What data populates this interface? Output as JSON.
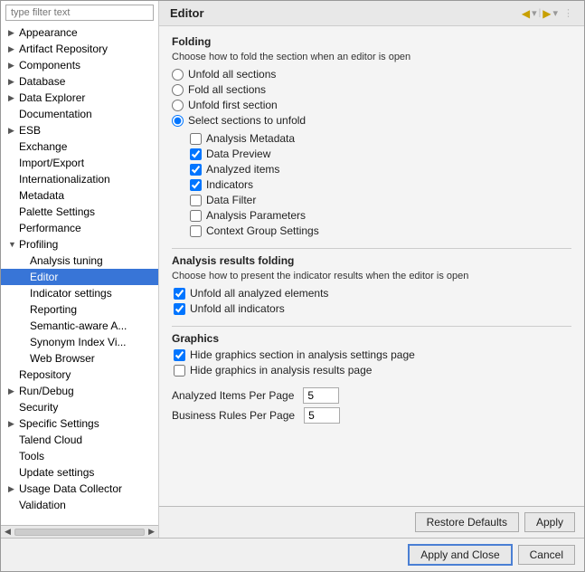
{
  "dialog": {
    "title": "Editor",
    "filter_placeholder": "type filter text"
  },
  "nav_arrows": {
    "back": "◀",
    "forward": "▶",
    "menu": "▾",
    "more": "⋮"
  },
  "tree": {
    "items": [
      {
        "id": "appearance",
        "label": "Appearance",
        "level": 0,
        "expanded": false
      },
      {
        "id": "artifact-repository",
        "label": "Artifact Repository",
        "level": 0,
        "expanded": false
      },
      {
        "id": "components",
        "label": "Components",
        "level": 0,
        "expanded": false
      },
      {
        "id": "database",
        "label": "Database",
        "level": 0,
        "expanded": false
      },
      {
        "id": "data-explorer",
        "label": "Data Explorer",
        "level": 0,
        "expanded": false
      },
      {
        "id": "documentation",
        "label": "Documentation",
        "level": 0,
        "expanded": false
      },
      {
        "id": "esb",
        "label": "ESB",
        "level": 0,
        "expanded": false
      },
      {
        "id": "exchange",
        "label": "Exchange",
        "level": 0,
        "expanded": false
      },
      {
        "id": "import-export",
        "label": "Import/Export",
        "level": 0,
        "expanded": false
      },
      {
        "id": "internationalization",
        "label": "Internationalization",
        "level": 0,
        "expanded": false
      },
      {
        "id": "metadata",
        "label": "Metadata",
        "level": 0,
        "expanded": false
      },
      {
        "id": "palette-settings",
        "label": "Palette Settings",
        "level": 0,
        "expanded": false
      },
      {
        "id": "performance",
        "label": "Performance",
        "level": 0,
        "expanded": false
      },
      {
        "id": "profiling",
        "label": "Profiling",
        "level": 0,
        "expanded": true,
        "arrow": "▼"
      },
      {
        "id": "analysis-tuning",
        "label": "Analysis tuning",
        "level": 1,
        "expanded": false
      },
      {
        "id": "editor",
        "label": "Editor",
        "level": 1,
        "expanded": false,
        "selected": true
      },
      {
        "id": "indicator-settings",
        "label": "Indicator settings",
        "level": 1,
        "expanded": false
      },
      {
        "id": "reporting",
        "label": "Reporting",
        "level": 1,
        "expanded": false
      },
      {
        "id": "semantic-aware",
        "label": "Semantic-aware A...",
        "level": 1,
        "expanded": false
      },
      {
        "id": "synonym-index",
        "label": "Synonym Index Vi...",
        "level": 1,
        "expanded": false
      },
      {
        "id": "web-browser",
        "label": "Web Browser",
        "level": 1,
        "expanded": false
      },
      {
        "id": "repository",
        "label": "Repository",
        "level": 0,
        "expanded": false
      },
      {
        "id": "run-debug",
        "label": "Run/Debug",
        "level": 0,
        "expanded": false
      },
      {
        "id": "security",
        "label": "Security",
        "level": 0,
        "expanded": false
      },
      {
        "id": "specific-settings",
        "label": "Specific Settings",
        "level": 0,
        "expanded": false
      },
      {
        "id": "talend-cloud",
        "label": "Talend Cloud",
        "level": 0,
        "expanded": false
      },
      {
        "id": "tools",
        "label": "Tools",
        "level": 0,
        "expanded": false
      },
      {
        "id": "update-settings",
        "label": "Update settings",
        "level": 0,
        "expanded": false
      },
      {
        "id": "usage-data-collector",
        "label": "Usage Data Collector",
        "level": 0,
        "expanded": false
      },
      {
        "id": "validation",
        "label": "Validation",
        "level": 0,
        "expanded": false
      }
    ]
  },
  "editor": {
    "folding": {
      "title": "Folding",
      "desc": "Choose how to fold the section when an editor is open",
      "options": [
        {
          "id": "unfold-all",
          "label": "Unfold all sections",
          "checked": false
        },
        {
          "id": "fold-all",
          "label": "Fold all sections",
          "checked": false
        },
        {
          "id": "unfold-first",
          "label": "Unfold first section",
          "checked": false
        },
        {
          "id": "select-sections",
          "label": "Select sections to unfold",
          "checked": true
        }
      ],
      "checkboxes": [
        {
          "id": "analysis-metadata",
          "label": "Analysis Metadata",
          "checked": false
        },
        {
          "id": "data-preview",
          "label": "Data Preview",
          "checked": true
        },
        {
          "id": "analyzed-items",
          "label": "Analyzed items",
          "checked": true
        },
        {
          "id": "indicators",
          "label": "Indicators",
          "checked": true
        },
        {
          "id": "data-filter",
          "label": "Data Filter",
          "checked": false
        },
        {
          "id": "analysis-parameters",
          "label": "Analysis Parameters",
          "checked": false
        },
        {
          "id": "context-group",
          "label": "Context Group Settings",
          "checked": false
        }
      ]
    },
    "analysis_results": {
      "title": "Analysis results folding",
      "desc": "Choose how to present the indicator results when the editor is open",
      "checkboxes": [
        {
          "id": "unfold-analyzed",
          "label": "Unfold all analyzed elements",
          "checked": true
        },
        {
          "id": "unfold-indicators",
          "label": "Unfold all indicators",
          "checked": true
        }
      ]
    },
    "graphics": {
      "title": "Graphics",
      "checkboxes": [
        {
          "id": "hide-graphics-settings",
          "label": "Hide graphics section in analysis settings page",
          "checked": true
        },
        {
          "id": "hide-graphics-results",
          "label": "Hide graphics in analysis results page",
          "checked": false
        }
      ]
    },
    "analyzed_items_per_page": {
      "label": "Analyzed Items Per Page",
      "value": "5"
    },
    "business_rules_per_page": {
      "label": "Business Rules Per Page",
      "value": "5"
    }
  },
  "buttons": {
    "restore_defaults": "Restore Defaults",
    "apply": "Apply",
    "apply_and_close": "Apply and Close",
    "cancel": "Cancel"
  }
}
